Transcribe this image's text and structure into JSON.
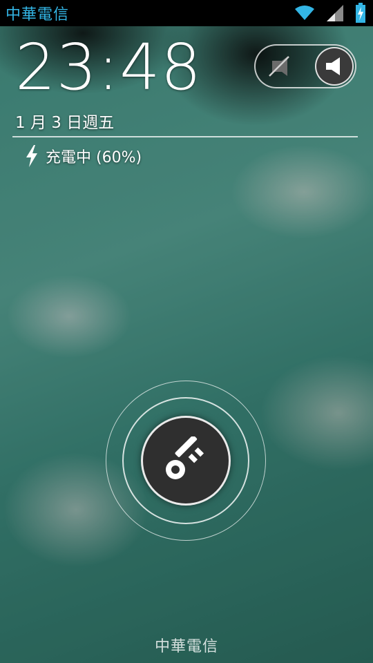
{
  "status_bar": {
    "carrier": "中華電信",
    "icons": [
      "wifi-icon",
      "signal-icon",
      "battery-charging-icon"
    ],
    "accent_color": "#33b5e5"
  },
  "lockscreen": {
    "time": "23:48",
    "date": "1 月 3 日週五",
    "charging_text": "充電中 (60%)",
    "battery_level_percent": 60,
    "carrier_footer": "中華電信"
  },
  "sound_toggle": {
    "options": [
      "vibrate-off-icon",
      "speaker-icon"
    ],
    "selected": "speaker-icon"
  },
  "unlock": {
    "handle_icon": "key-icon"
  }
}
